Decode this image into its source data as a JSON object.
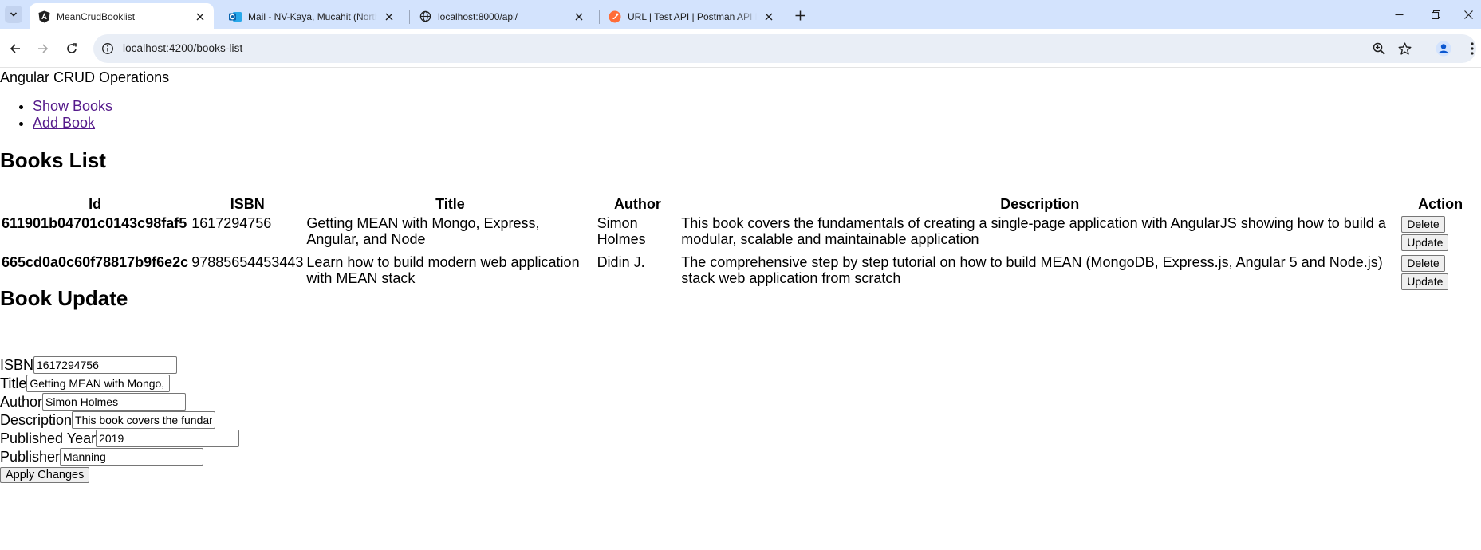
{
  "browser": {
    "tabs": [
      {
        "title": "MeanCrudBooklist",
        "icon": "angular-icon"
      },
      {
        "title": "Mail - NV-Kaya, Mucahit (North",
        "icon": "outlook-icon"
      },
      {
        "title": "localhost:8000/api/",
        "icon": "globe-icon"
      },
      {
        "title": "URL | Test API | Postman API Ne",
        "icon": "postman-icon"
      }
    ],
    "url": "localhost:4200/books-list",
    "accent": "#d3e3fd"
  },
  "app": {
    "title": "Angular CRUD Operations",
    "nav": [
      {
        "label": "Show Books"
      },
      {
        "label": "Add Book"
      }
    ]
  },
  "books_list": {
    "heading": "Books List",
    "columns": {
      "id": "Id",
      "isbn": "ISBN",
      "title": "Title",
      "author": "Author",
      "description": "Description",
      "action": "Action"
    },
    "rows": [
      {
        "id": "611901b04701c0143c98faf5",
        "isbn": "1617294756",
        "title": "Getting MEAN with Mongo, Express, Angular, and Node",
        "author": "Simon Holmes",
        "description": "This book covers the fundamentals of creating a single-page application with AngularJS showing how to build a modular, scalable and maintainable application",
        "delete_label": "Delete",
        "update_label": "Update"
      },
      {
        "id": "665cd0a0c60f78817b9f6e2c",
        "isbn": "97885654453443",
        "title": "Learn how to build modern web application with MEAN stack",
        "author": "Didin J.",
        "description": "The comprehensive step by step tutorial on how to build MEAN (MongoDB, Express.js, Angular 5 and Node.js) stack web application from scratch",
        "delete_label": "Delete",
        "update_label": "Update"
      }
    ]
  },
  "book_update": {
    "heading": "Book Update",
    "fields": [
      {
        "label": "ISBN",
        "value": "1617294756"
      },
      {
        "label": "Title",
        "value": "Getting MEAN with Mongo, Express, Angular, and Node"
      },
      {
        "label": "Author",
        "value": "Simon Holmes"
      },
      {
        "label": "Description",
        "value": "This book covers the fundamentals of creating a single-page application with AngularJS showing how to build a modular, scalable and maintainable application"
      },
      {
        "label": "Published Year",
        "value": "2019"
      },
      {
        "label": "Publisher",
        "value": "Manning"
      }
    ],
    "apply_label": "Apply Changes"
  }
}
